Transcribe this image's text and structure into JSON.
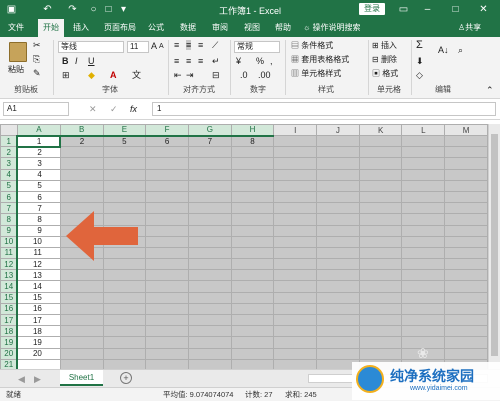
{
  "titlebar": {
    "title": "工作簿1 - Excel",
    "login_label": "登录",
    "icons": [
      "save-icon",
      "undo-icon",
      "redo-icon",
      "circle-icon",
      "rectangle-icon",
      "customize-icon",
      "ribbon-display-icon",
      "minimize-icon",
      "maximize-icon",
      "close-icon"
    ]
  },
  "tabs": [
    "文件",
    "开始",
    "插入",
    "页面布局",
    "公式",
    "数据",
    "审阅",
    "视图",
    "帮助"
  ],
  "active_tab": "开始",
  "search_label": "操作说明搜索",
  "share_label": "共享",
  "ribbon": {
    "clipboard": {
      "paste": "粘贴",
      "label": "剪贴板"
    },
    "font": {
      "name": "等线",
      "size": "11",
      "label": "字体",
      "bold": "B",
      "italic": "I",
      "underline": "U",
      "grow": "A",
      "shrink": "A"
    },
    "alignment": {
      "label": "对齐方式"
    },
    "number": {
      "format": "常规",
      "percent": "%",
      "comma": ",",
      "label": "数字"
    },
    "styles": {
      "conditional": "条件格式",
      "table": "套用表格格式",
      "cell": "单元格样式",
      "label": "样式"
    },
    "cells": {
      "insert": "插入",
      "delete": "删除",
      "format": "格式",
      "label": "单元格"
    },
    "editing": {
      "sum": "Σ",
      "label": "编辑"
    }
  },
  "formula_bar": {
    "name_box": "A1",
    "value": "1"
  },
  "grid": {
    "columns": [
      "A",
      "B",
      "E",
      "F",
      "G",
      "H",
      "I",
      "J",
      "K",
      "L",
      "M"
    ],
    "row1": [
      "1",
      "2",
      "5",
      "6",
      "7",
      "8",
      "",
      "",
      "",
      "",
      ""
    ],
    "colA": [
      "1",
      "2",
      "3",
      "4",
      "5",
      "6",
      "7",
      "8",
      "9",
      "10",
      "11",
      "12",
      "13",
      "14",
      "15",
      "16",
      "17",
      "18",
      "19",
      "20",
      ""
    ],
    "rows": [
      "1",
      "2",
      "3",
      "4",
      "5",
      "6",
      "7",
      "8",
      "9",
      "10",
      "11",
      "12",
      "13",
      "14",
      "15",
      "16",
      "17",
      "18",
      "19",
      "20",
      "21"
    ]
  },
  "sheetbar": {
    "sheet": "Sheet1",
    "add": "+"
  },
  "status": {
    "ready": "就绪",
    "average": "平均值: 9.074074074",
    "count": "计数: 27",
    "sum": "求和: 245"
  },
  "watermark": {
    "text": "纯净系统家园",
    "url": "www.yidaimei.com"
  },
  "colors": {
    "excel_green": "#217346",
    "arrow": "#e0653c",
    "selected_fill": "#c8c8c8"
  }
}
